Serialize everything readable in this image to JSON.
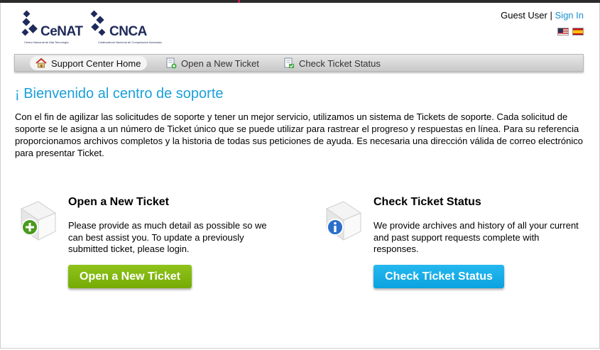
{
  "header": {
    "logos": [
      {
        "name": "CeNAT",
        "subtitle": "Centro Nacional de Alta Tecnología"
      },
      {
        "name": "CNCA",
        "subtitle": "Colaboratorio Nacional de Computación Avanzada"
      }
    ],
    "user_label": "Guest User",
    "separator": "|",
    "sign_in": "Sign In",
    "flags": [
      "us-flag-icon",
      "spain-flag-icon"
    ]
  },
  "nav": {
    "items": [
      {
        "label": "Support Center Home",
        "icon": "home-icon"
      },
      {
        "label": "Open a New Ticket",
        "icon": "new-ticket-icon"
      },
      {
        "label": "Check Ticket Status",
        "icon": "ticket-status-icon"
      }
    ]
  },
  "main": {
    "title": "¡ Bienvenido al centro de soporte",
    "intro": "Con el fin de agilizar las solicitudes de soporte y tener un mejor servicio, utilizamos un sistema de Tickets de soporte. Cada solicitud de soporte se le asigna a un número de Ticket único que se puede utilizar para rastrear el progreso y respuestas en línea. Para su referencia proporcionamos archivos completos y la historia de todas sus peticiones de ayuda. Es necesaria una dirección válida de correo electrónico para presentar Ticket.",
    "open_ticket": {
      "title": "Open a New Ticket",
      "text": "Please provide as much detail as possible so we can best assist you. To update a previously submitted ticket, please login.",
      "button": "Open a New Ticket"
    },
    "check_status": {
      "title": "Check Ticket Status",
      "text": "We provide archives and history of all your current and past support requests complete with responses.",
      "button": "Check Ticket Status"
    }
  },
  "colors": {
    "accent_blue": "#1a9fd9",
    "button_green": "#7fb70f",
    "button_blue": "#14abe6",
    "logo_navy": "#1e2a5a"
  }
}
